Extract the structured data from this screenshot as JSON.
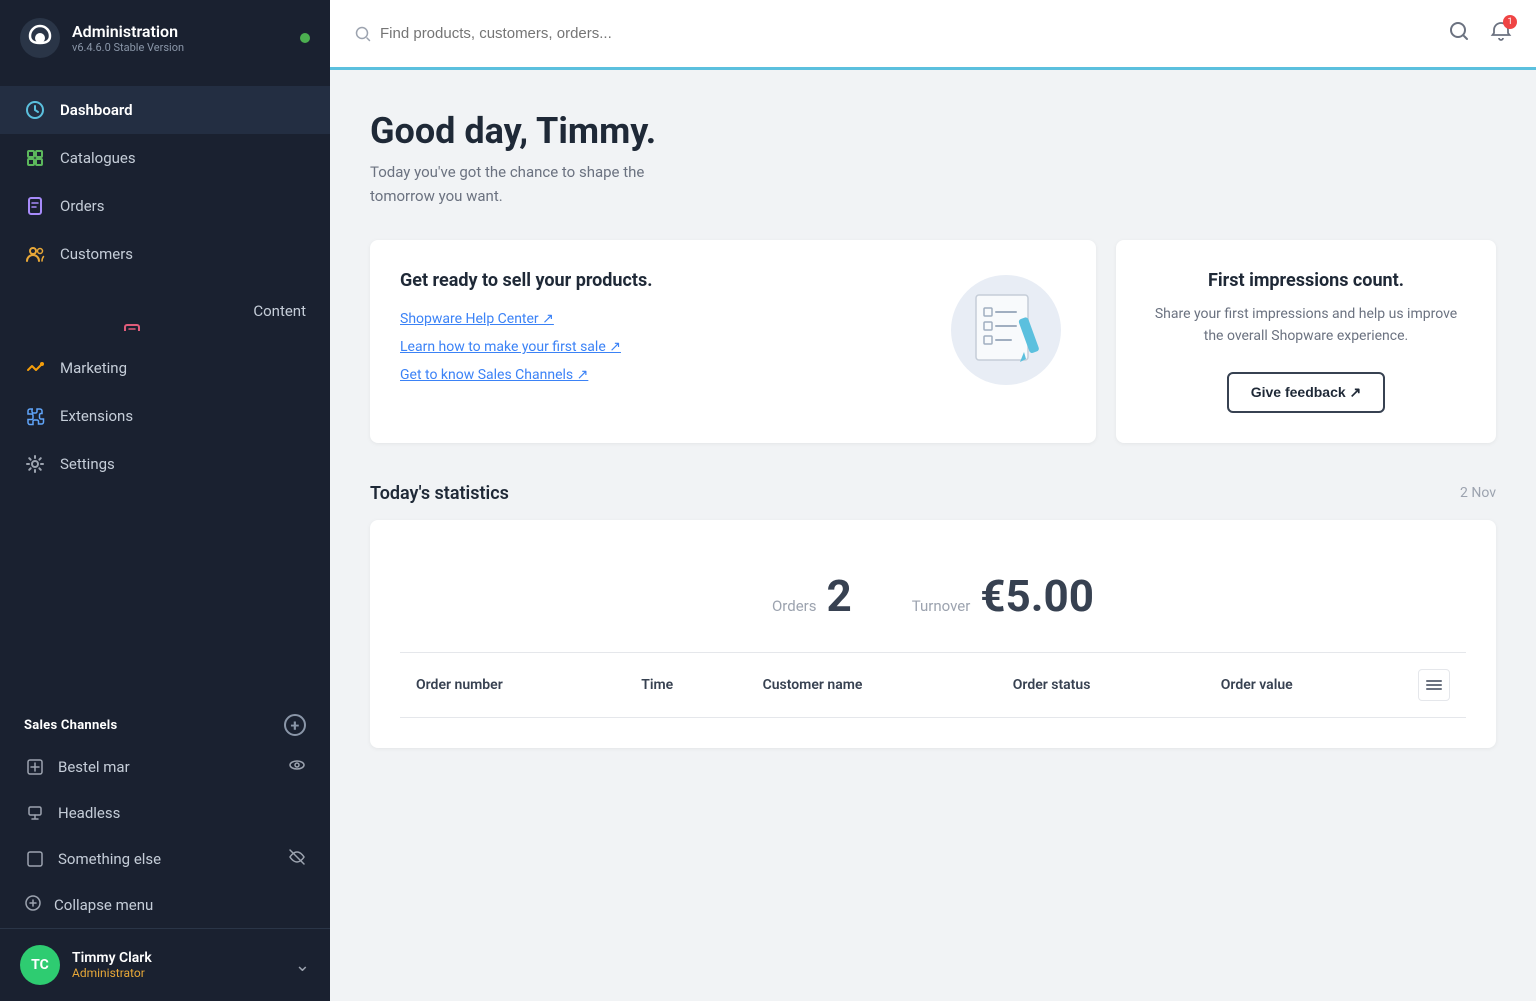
{
  "sidebar": {
    "brand": {
      "title": "Administration",
      "version": "v6.4.6.0 Stable Version"
    },
    "nav_items": [
      {
        "id": "dashboard",
        "label": "Dashboard",
        "icon": "dashboard",
        "active": true
      },
      {
        "id": "catalogues",
        "label": "Catalogues",
        "icon": "catalogues",
        "active": false
      },
      {
        "id": "orders",
        "label": "Orders",
        "icon": "orders",
        "active": false
      },
      {
        "id": "customers",
        "label": "Customers",
        "icon": "customers",
        "active": false
      },
      {
        "id": "content",
        "label": "Content",
        "icon": "content",
        "active": false
      },
      {
        "id": "marketing",
        "label": "Marketing",
        "icon": "marketing",
        "active": false
      },
      {
        "id": "extensions",
        "label": "Extensions",
        "icon": "extensions",
        "active": false
      },
      {
        "id": "settings",
        "label": "Settings",
        "icon": "settings",
        "active": false
      }
    ],
    "sales_channels_title": "Sales Channels",
    "sales_channels": [
      {
        "id": "bestel-mar",
        "label": "Bestel mar",
        "has_eye": true
      },
      {
        "id": "headless",
        "label": "Headless",
        "has_eye": false
      },
      {
        "id": "something-else",
        "label": "Something else",
        "has_eye": true
      }
    ],
    "collapse_label": "Collapse menu",
    "user": {
      "initials": "TC",
      "name": "Timmy Clark",
      "role": "Administrator"
    }
  },
  "topbar": {
    "search_placeholder": "Find products, customers, orders..."
  },
  "main": {
    "greeting": "Good day, Timmy.",
    "greeting_sub_line1": "Today you've got the chance to shape the",
    "greeting_sub_line2": "tomorrow you want.",
    "sell_card": {
      "title": "Get ready to sell your products.",
      "links": [
        {
          "id": "help-center",
          "label": "Shopware Help Center ↗"
        },
        {
          "id": "first-sale",
          "label": "Learn how to make your first sale ↗"
        },
        {
          "id": "sales-channels",
          "label": "Get to know Sales Channels ↗"
        }
      ]
    },
    "impressions_card": {
      "title": "First impressions count.",
      "description": "Share your first impressions and help us improve the overall Shopware experience.",
      "button_label": "Give feedback ↗"
    },
    "stats": {
      "section_title": "Today's statistics",
      "date": "2 Nov",
      "orders_label": "Orders",
      "orders_value": "2",
      "turnover_label": "Turnover",
      "turnover_value": "€5.00"
    },
    "table": {
      "columns": [
        {
          "id": "order-number",
          "label": "Order number"
        },
        {
          "id": "time",
          "label": "Time"
        },
        {
          "id": "customer-name",
          "label": "Customer name"
        },
        {
          "id": "order-status",
          "label": "Order status"
        },
        {
          "id": "order-value",
          "label": "Order value"
        },
        {
          "id": "menu",
          "label": ""
        }
      ]
    }
  }
}
